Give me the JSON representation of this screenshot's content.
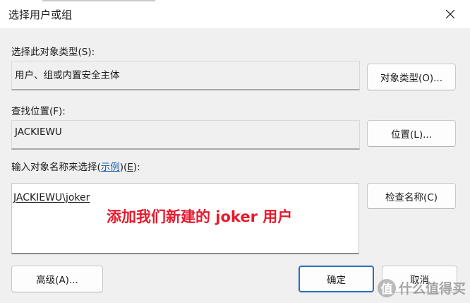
{
  "window": {
    "title": "选择用户或组"
  },
  "object_type": {
    "label": "选择此对象类型(S):",
    "value": "用户、组或内置安全主体",
    "button": "对象类型(O)..."
  },
  "location": {
    "label": "查找位置(F):",
    "value": "JACKIEWU",
    "button": "位置(L)..."
  },
  "names": {
    "label_before": "输入对象名称来选择(",
    "link": "示例",
    "label_middle": ")(",
    "label_key": "E",
    "label_after": "):",
    "value": "JACKIEWU\\joker",
    "check_button": "检查名称(C)"
  },
  "annotation": "添加我们新建的 joker 用户",
  "footer": {
    "advanced": "高级(A)...",
    "ok": "确定",
    "cancel": "取消"
  },
  "watermark": {
    "logo": "值",
    "text": "什么值得买"
  }
}
